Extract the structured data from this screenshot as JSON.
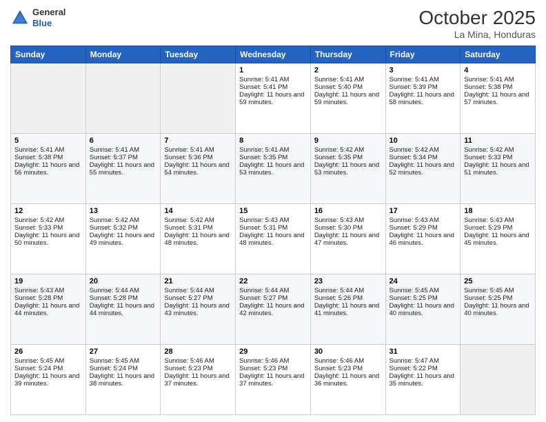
{
  "header": {
    "logo": {
      "general": "General",
      "blue": "Blue"
    },
    "month": "October 2025",
    "location": "La Mina, Honduras"
  },
  "days_of_week": [
    "Sunday",
    "Monday",
    "Tuesday",
    "Wednesday",
    "Thursday",
    "Friday",
    "Saturday"
  ],
  "weeks": [
    [
      {
        "day": "",
        "sunrise": "",
        "sunset": "",
        "daylight": "",
        "empty": true
      },
      {
        "day": "",
        "sunrise": "",
        "sunset": "",
        "daylight": "",
        "empty": true
      },
      {
        "day": "",
        "sunrise": "",
        "sunset": "",
        "daylight": "",
        "empty": true
      },
      {
        "day": "1",
        "sunrise": "Sunrise: 5:41 AM",
        "sunset": "Sunset: 5:41 PM",
        "daylight": "Daylight: 11 hours and 59 minutes."
      },
      {
        "day": "2",
        "sunrise": "Sunrise: 5:41 AM",
        "sunset": "Sunset: 5:40 PM",
        "daylight": "Daylight: 11 hours and 59 minutes."
      },
      {
        "day": "3",
        "sunrise": "Sunrise: 5:41 AM",
        "sunset": "Sunset: 5:39 PM",
        "daylight": "Daylight: 11 hours and 58 minutes."
      },
      {
        "day": "4",
        "sunrise": "Sunrise: 5:41 AM",
        "sunset": "Sunset: 5:38 PM",
        "daylight": "Daylight: 11 hours and 57 minutes."
      }
    ],
    [
      {
        "day": "5",
        "sunrise": "Sunrise: 5:41 AM",
        "sunset": "Sunset: 5:38 PM",
        "daylight": "Daylight: 11 hours and 56 minutes."
      },
      {
        "day": "6",
        "sunrise": "Sunrise: 5:41 AM",
        "sunset": "Sunset: 5:37 PM",
        "daylight": "Daylight: 11 hours and 55 minutes."
      },
      {
        "day": "7",
        "sunrise": "Sunrise: 5:41 AM",
        "sunset": "Sunset: 5:36 PM",
        "daylight": "Daylight: 11 hours and 54 minutes."
      },
      {
        "day": "8",
        "sunrise": "Sunrise: 5:41 AM",
        "sunset": "Sunset: 5:35 PM",
        "daylight": "Daylight: 11 hours and 53 minutes."
      },
      {
        "day": "9",
        "sunrise": "Sunrise: 5:42 AM",
        "sunset": "Sunset: 5:35 PM",
        "daylight": "Daylight: 11 hours and 53 minutes."
      },
      {
        "day": "10",
        "sunrise": "Sunrise: 5:42 AM",
        "sunset": "Sunset: 5:34 PM",
        "daylight": "Daylight: 11 hours and 52 minutes."
      },
      {
        "day": "11",
        "sunrise": "Sunrise: 5:42 AM",
        "sunset": "Sunset: 5:33 PM",
        "daylight": "Daylight: 11 hours and 51 minutes."
      }
    ],
    [
      {
        "day": "12",
        "sunrise": "Sunrise: 5:42 AM",
        "sunset": "Sunset: 5:33 PM",
        "daylight": "Daylight: 11 hours and 50 minutes."
      },
      {
        "day": "13",
        "sunrise": "Sunrise: 5:42 AM",
        "sunset": "Sunset: 5:32 PM",
        "daylight": "Daylight: 11 hours and 49 minutes."
      },
      {
        "day": "14",
        "sunrise": "Sunrise: 5:42 AM",
        "sunset": "Sunset: 5:31 PM",
        "daylight": "Daylight: 11 hours and 48 minutes."
      },
      {
        "day": "15",
        "sunrise": "Sunrise: 5:43 AM",
        "sunset": "Sunset: 5:31 PM",
        "daylight": "Daylight: 11 hours and 48 minutes."
      },
      {
        "day": "16",
        "sunrise": "Sunrise: 5:43 AM",
        "sunset": "Sunset: 5:30 PM",
        "daylight": "Daylight: 11 hours and 47 minutes."
      },
      {
        "day": "17",
        "sunrise": "Sunrise: 5:43 AM",
        "sunset": "Sunset: 5:29 PM",
        "daylight": "Daylight: 11 hours and 46 minutes."
      },
      {
        "day": "18",
        "sunrise": "Sunrise: 5:43 AM",
        "sunset": "Sunset: 5:29 PM",
        "daylight": "Daylight: 11 hours and 45 minutes."
      }
    ],
    [
      {
        "day": "19",
        "sunrise": "Sunrise: 5:43 AM",
        "sunset": "Sunset: 5:28 PM",
        "daylight": "Daylight: 11 hours and 44 minutes."
      },
      {
        "day": "20",
        "sunrise": "Sunrise: 5:44 AM",
        "sunset": "Sunset: 5:28 PM",
        "daylight": "Daylight: 11 hours and 44 minutes."
      },
      {
        "day": "21",
        "sunrise": "Sunrise: 5:44 AM",
        "sunset": "Sunset: 5:27 PM",
        "daylight": "Daylight: 11 hours and 43 minutes."
      },
      {
        "day": "22",
        "sunrise": "Sunrise: 5:44 AM",
        "sunset": "Sunset: 5:27 PM",
        "daylight": "Daylight: 11 hours and 42 minutes."
      },
      {
        "day": "23",
        "sunrise": "Sunrise: 5:44 AM",
        "sunset": "Sunset: 5:26 PM",
        "daylight": "Daylight: 11 hours and 41 minutes."
      },
      {
        "day": "24",
        "sunrise": "Sunrise: 5:45 AM",
        "sunset": "Sunset: 5:25 PM",
        "daylight": "Daylight: 11 hours and 40 minutes."
      },
      {
        "day": "25",
        "sunrise": "Sunrise: 5:45 AM",
        "sunset": "Sunset: 5:25 PM",
        "daylight": "Daylight: 11 hours and 40 minutes."
      }
    ],
    [
      {
        "day": "26",
        "sunrise": "Sunrise: 5:45 AM",
        "sunset": "Sunset: 5:24 PM",
        "daylight": "Daylight: 11 hours and 39 minutes."
      },
      {
        "day": "27",
        "sunrise": "Sunrise: 5:45 AM",
        "sunset": "Sunset: 5:24 PM",
        "daylight": "Daylight: 11 hours and 38 minutes."
      },
      {
        "day": "28",
        "sunrise": "Sunrise: 5:46 AM",
        "sunset": "Sunset: 5:23 PM",
        "daylight": "Daylight: 11 hours and 37 minutes."
      },
      {
        "day": "29",
        "sunrise": "Sunrise: 5:46 AM",
        "sunset": "Sunset: 5:23 PM",
        "daylight": "Daylight: 11 hours and 37 minutes."
      },
      {
        "day": "30",
        "sunrise": "Sunrise: 5:46 AM",
        "sunset": "Sunset: 5:23 PM",
        "daylight": "Daylight: 11 hours and 36 minutes."
      },
      {
        "day": "31",
        "sunrise": "Sunrise: 5:47 AM",
        "sunset": "Sunset: 5:22 PM",
        "daylight": "Daylight: 11 hours and 35 minutes."
      },
      {
        "day": "",
        "sunrise": "",
        "sunset": "",
        "daylight": "",
        "empty": true
      }
    ]
  ]
}
